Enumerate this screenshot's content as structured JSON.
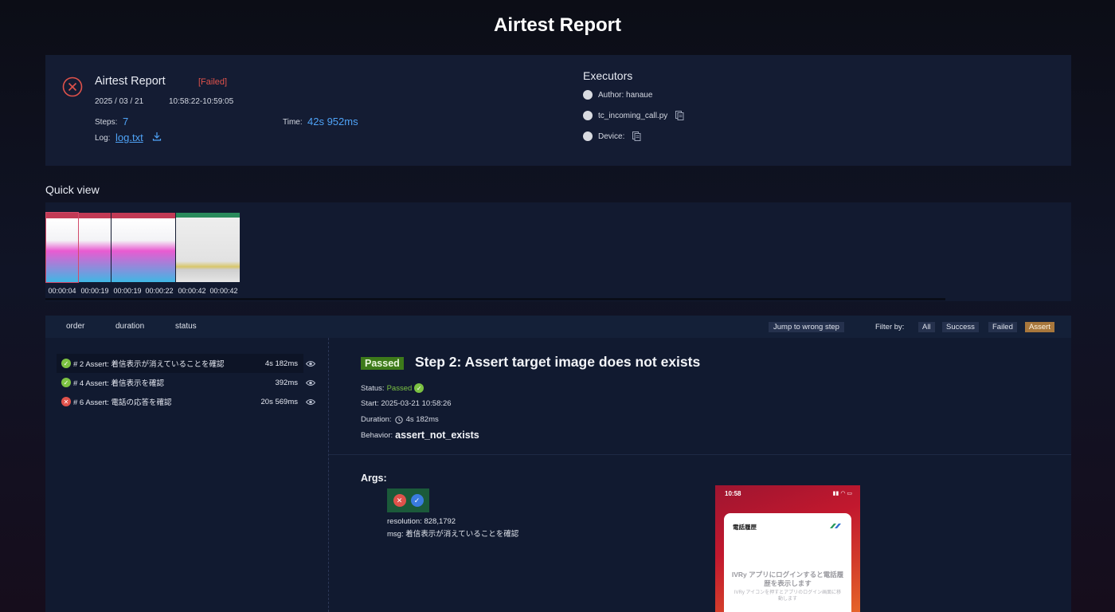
{
  "page": {
    "title": "Airtest Report"
  },
  "summary": {
    "title": "Airtest Report",
    "status": "[Failed]",
    "date": "2025 / 03 / 21",
    "time_range": "10:58:22-10:59:05",
    "steps_label": "Steps:",
    "steps_value": "7",
    "time_label": "Time:",
    "time_value": "42s 952ms",
    "log_label": "Log:",
    "log_link": "log.txt"
  },
  "executors": {
    "title": "Executors",
    "author": "Author: hanaue",
    "script": "tc_incoming_call.py",
    "device": "Device:"
  },
  "quick_view": {
    "label": "Quick view",
    "thumbnails": [
      {
        "time": "00:00:04",
        "theme": "pink"
      },
      {
        "time": "00:00:19",
        "theme": "pink"
      },
      {
        "time": "00:00:19",
        "theme": "pink"
      },
      {
        "time": "00:00:22",
        "theme": "pink"
      },
      {
        "time": "00:00:42",
        "theme": "gray"
      },
      {
        "time": "00:00:42",
        "theme": "gray"
      }
    ]
  },
  "toolbar": {
    "sort_order": "order",
    "sort_duration": "duration",
    "sort_status": "status",
    "jump": "Jump to wrong step",
    "filter_label": "Filter by:",
    "filter_all": "All",
    "filter_success": "Success",
    "filter_failed": "Failed",
    "filter_assert": "Assert"
  },
  "steps": [
    {
      "label": "# 2 Assert: 着信表示が消えていることを確認",
      "duration": "4s 182ms",
      "status": "ok"
    },
    {
      "label": "# 4 Assert: 着信表示を確認",
      "duration": "392ms",
      "status": "ok"
    },
    {
      "label": "# 6 Assert: 電話の応答を確認",
      "duration": "20s 569ms",
      "status": "bad"
    }
  ],
  "detail": {
    "badge": "Passed",
    "title": "Step 2: Assert target image does not exists",
    "status_label": "Status:",
    "status_value": "Passed",
    "start": "Start: 2025-03-21 10:58:26",
    "duration_label": "Duration:",
    "duration_value": "4s 182ms",
    "behavior_label": "Behavior:",
    "behavior_value": "assert_not_exists"
  },
  "args": {
    "label": "Args:",
    "resolution": "resolution: 828,1792",
    "msg": "msg: 着信表示が消えていることを確認"
  },
  "screenshot": {
    "time": "10:58",
    "card_title": "電話履歴",
    "message": "IVRy アプリにログインすると電話履歴を表示します",
    "sub_message": "IVRy アイコンを押すとアプリのログイン画面に移動します"
  },
  "colors": {
    "accent_blue": "#4fa3f7",
    "failed_red": "#e0524b",
    "passed_green": "#7cc242",
    "assert_orange": "#a8773c"
  }
}
